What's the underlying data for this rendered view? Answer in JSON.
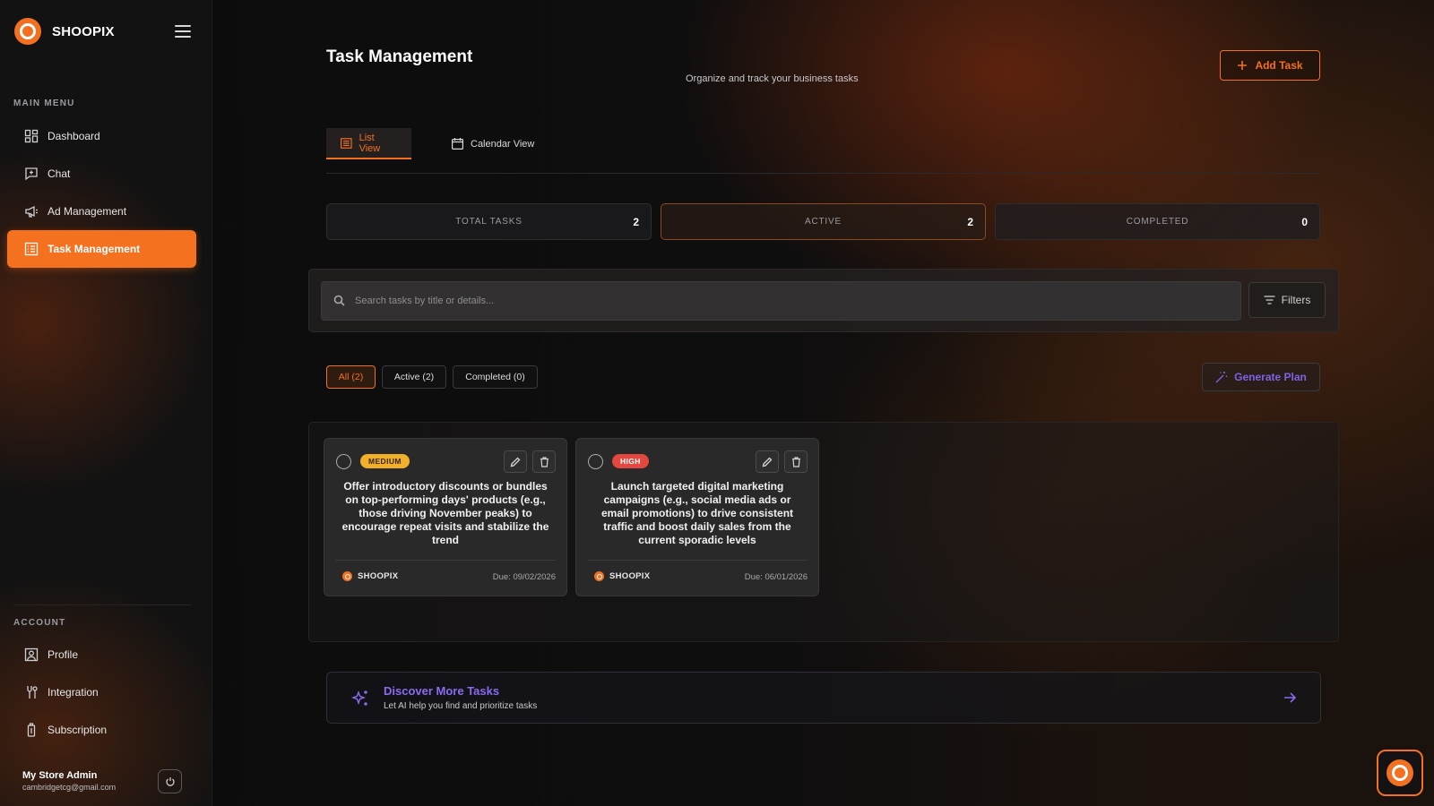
{
  "brand": {
    "name": "SHOOPIX"
  },
  "sidebar": {
    "main_menu_label": "MAIN MENU",
    "items": [
      {
        "label": "Dashboard",
        "icon": "dashboard-icon"
      },
      {
        "label": "Chat",
        "icon": "chat-icon"
      },
      {
        "label": "Ad Management",
        "icon": "megaphone-icon"
      },
      {
        "label": "Task Management",
        "icon": "task-list-icon",
        "active": true
      }
    ],
    "account_label": "ACCOUNT",
    "account_items": [
      {
        "label": "Profile",
        "icon": "profile-icon"
      },
      {
        "label": "Integration",
        "icon": "integration-icon"
      },
      {
        "label": "Subscription",
        "icon": "subscription-icon"
      }
    ],
    "user": {
      "name": "My Store Admin",
      "email": "cambridgetcg@gmail.com"
    }
  },
  "header": {
    "title": "Task Management",
    "subtitle": "Organize and track your business tasks",
    "add_task_label": "Add Task"
  },
  "tabs": [
    {
      "label": "List View",
      "active": true
    },
    {
      "label": "Calendar View",
      "active": false
    }
  ],
  "stats": [
    {
      "label": "TOTAL TASKS",
      "value": "2"
    },
    {
      "label": "ACTIVE",
      "value": "2"
    },
    {
      "label": "COMPLETED",
      "value": "0"
    }
  ],
  "search": {
    "placeholder": "Search tasks by title or details...",
    "value": "",
    "filters_label": "Filters"
  },
  "filter_chips": [
    {
      "label": "All (2)",
      "active": true
    },
    {
      "label": "Active (2)",
      "active": false
    },
    {
      "label": "Completed (0)",
      "active": false
    }
  ],
  "generate_plan_label": "Generate Plan",
  "tasks": [
    {
      "priority": "MEDIUM",
      "text": "Offer introductory discounts or bundles on top-performing days' products (e.g., those driving November peaks) to encourage repeat visits and stabilize the trend",
      "store": "SHOOPIX",
      "due": "Due: 09/02/2026"
    },
    {
      "priority": "HIGH",
      "text": "Launch targeted digital marketing campaigns (e.g., social media ads or email promotions) to drive consistent traffic and boost daily sales from the current sporadic levels",
      "store": "SHOOPIX",
      "due": "Due: 06/01/2026"
    }
  ],
  "discover": {
    "title": "Discover More Tasks",
    "subtitle": "Let AI help you find and prioritize tasks"
  },
  "colors": {
    "accent": "#f37021",
    "purple": "#8b6cf0",
    "badge_medium": "#f0b02a",
    "badge_high": "#e2483f"
  }
}
